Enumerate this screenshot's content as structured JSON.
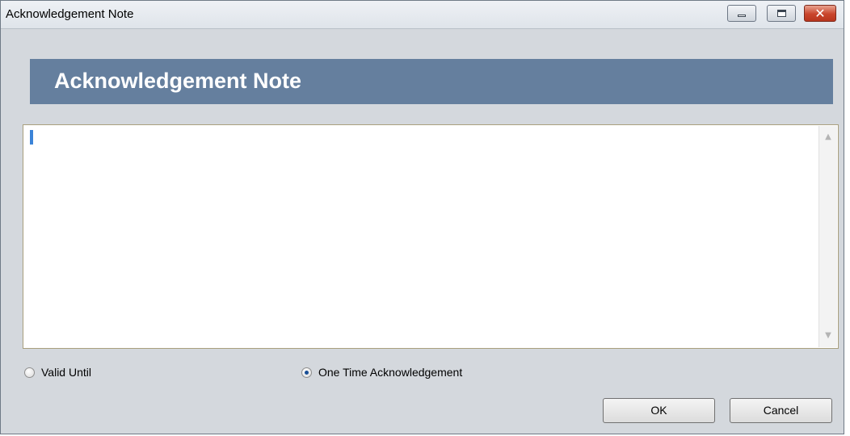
{
  "window": {
    "title": "Acknowledgement Note",
    "controls": {
      "minimize": "minimize-icon",
      "maximize": "maximize-icon",
      "close": "close-icon",
      "close_glyph": "✕"
    }
  },
  "header": {
    "title": "Acknowledgement Note"
  },
  "note": {
    "value": "",
    "scroll_up": "▲",
    "scroll_down": "▼"
  },
  "options": {
    "valid_until": {
      "label": "Valid Until",
      "checked": false
    },
    "one_time": {
      "label": "One Time Acknowledgement",
      "checked": true
    }
  },
  "buttons": {
    "ok": "OK",
    "cancel": "Cancel"
  },
  "colors": {
    "banner": "#657f9e",
    "dialog_bg": "#d4d8dd",
    "close_button": "#c9452c",
    "caret": "#3b84d8"
  }
}
